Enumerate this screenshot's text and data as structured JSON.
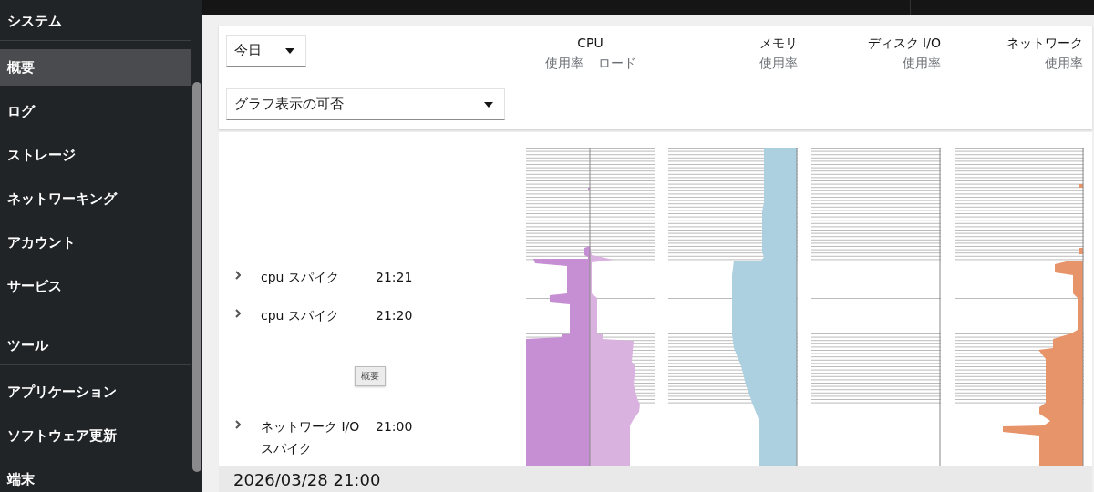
{
  "sidebar": {
    "groups": [
      {
        "heading": "システム",
        "items": [
          {
            "label": "概要",
            "selected": true
          },
          {
            "label": "ログ",
            "selected": false
          },
          {
            "label": "ストレージ",
            "selected": false
          },
          {
            "label": "ネットワーキング",
            "selected": false
          },
          {
            "label": "アカウント",
            "selected": false
          },
          {
            "label": "サービス",
            "selected": false
          }
        ]
      },
      {
        "heading": "ツール",
        "items": [
          {
            "label": "アプリケーション",
            "selected": false
          },
          {
            "label": "ソフトウェア更新",
            "selected": false
          },
          {
            "label": "端末",
            "selected": false
          }
        ]
      }
    ]
  },
  "filters": {
    "range_select": {
      "value": "今日"
    },
    "graph_select": {
      "value": "グラフ表示の可否"
    }
  },
  "columns": [
    {
      "kind": "cpu",
      "title": "CPU",
      "subtitles": [
        "使用率",
        "ロード"
      ]
    },
    {
      "kind": "memory",
      "title": "メモリ",
      "subtitles": [
        "使用率"
      ]
    },
    {
      "kind": "disk",
      "title": "ディスク I/O",
      "subtitles": [
        "使用率"
      ]
    },
    {
      "kind": "network",
      "title": "ネットワーク",
      "subtitles": [
        "使用率"
      ]
    }
  ],
  "events": [
    {
      "label": "cpu スパイク",
      "time": "21:21",
      "expanded": false
    },
    {
      "label": "cpu スパイク",
      "time": "21:20",
      "expanded": false
    },
    {
      "label": "ネットワーク I/O スパイク",
      "time": "21:00",
      "expanded": false
    }
  ],
  "tooltip": "概要",
  "next_hour": "2026/03/28 21:00"
}
